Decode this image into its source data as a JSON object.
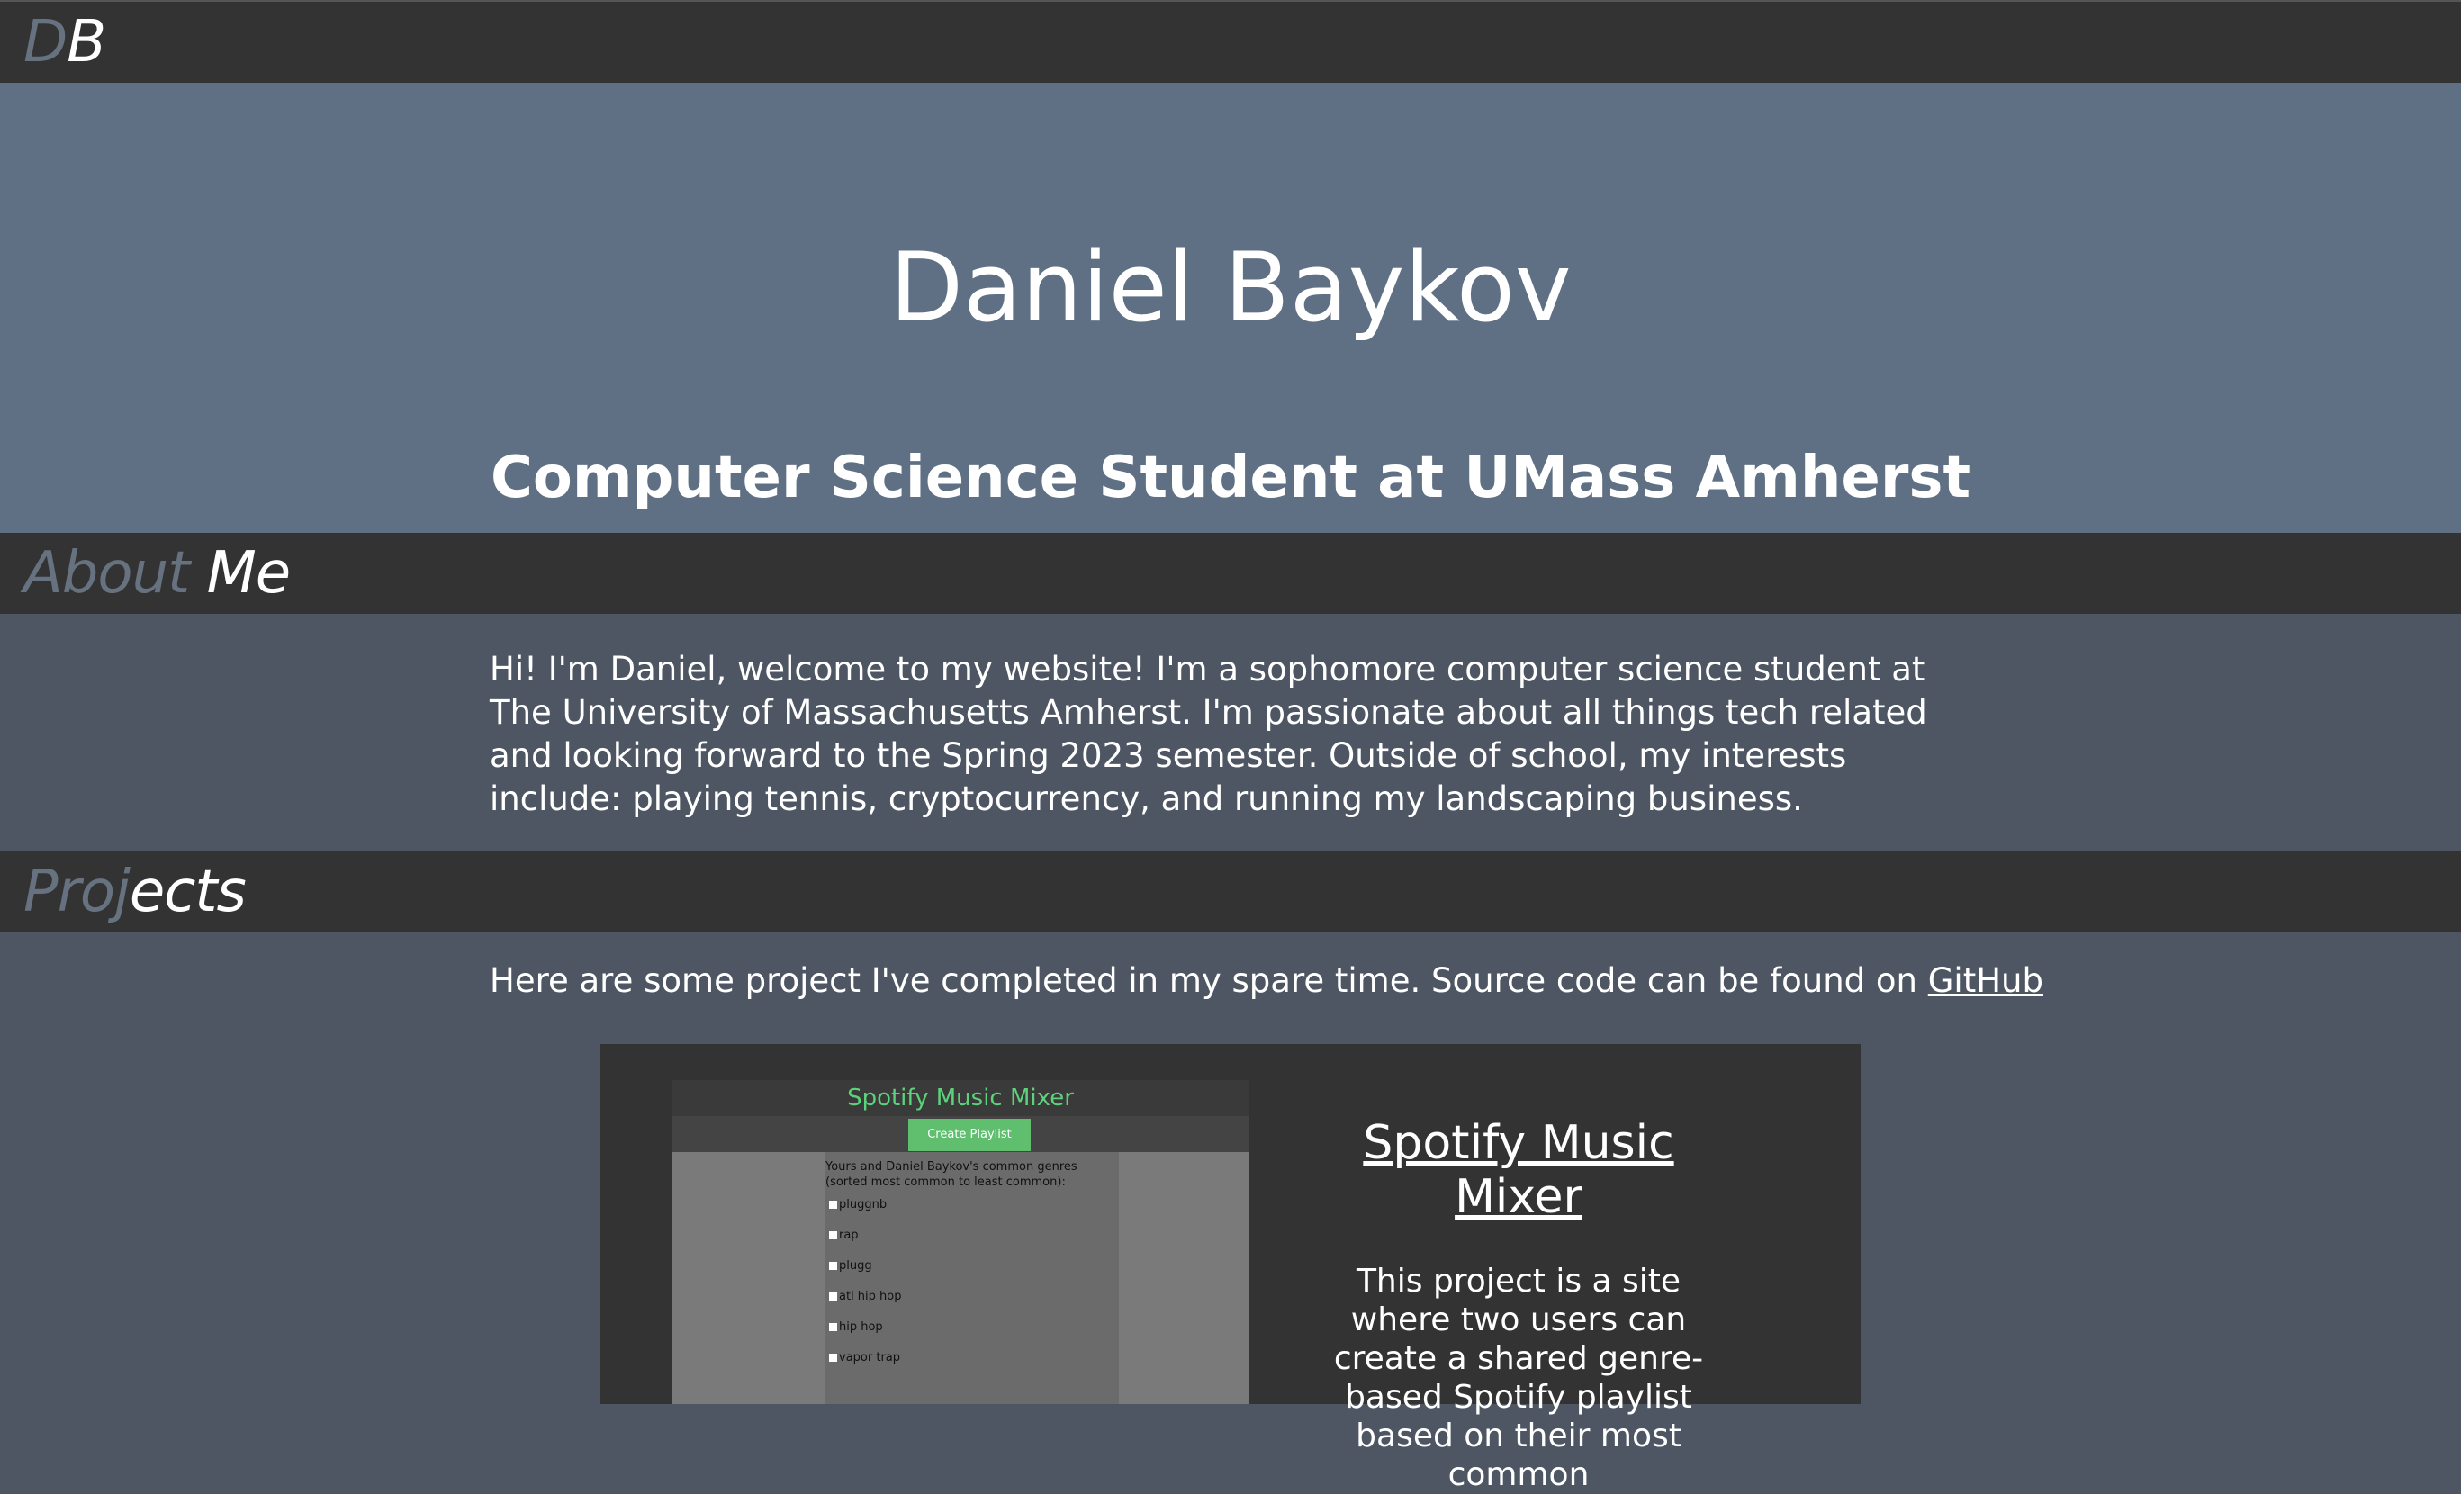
{
  "topbar": {
    "logo_dim": "D",
    "logo_bright": "B"
  },
  "hero": {
    "name": "Daniel Baykov",
    "subtitle": "Computer Science Student at UMass Amherst"
  },
  "about": {
    "heading_dim": "About",
    "heading_bright": "Me",
    "text": "Hi! I'm Daniel, welcome to my website! I'm a sophomore computer science student at The University of Massachusetts Amherst. I'm passionate about all things tech related and looking forward to the Spring 2023 semester. Outside of school, my interests include: playing tennis, cryptocurrency, and running my landscaping business."
  },
  "projects": {
    "heading_dim": "Proj",
    "heading_bright": "ects",
    "intro": "Here are some project I've completed in my spare time. Source code can be found on ",
    "github_link": "GitHub",
    "items": [
      {
        "title": "Spotify Music Mixer",
        "description": "This project is a site where two users can create a shared genre-based Spotify playlist based on their most common",
        "screenshot": {
          "header": "Spotify Music Mixer",
          "button": "Create Playlist",
          "panel_heading": "Yours and Daniel Baykov's common genres (sorted most common to least common):",
          "genres": [
            "pluggnb",
            "rap",
            "plugg",
            "atl hip hop",
            "hip hop",
            "vapor trap"
          ]
        }
      }
    ]
  },
  "colors": {
    "bar": "#333333",
    "hero": "#5f7084",
    "body": "#4d5662",
    "dim_text": "#66727f",
    "spotify_green": "#5cd27a"
  }
}
